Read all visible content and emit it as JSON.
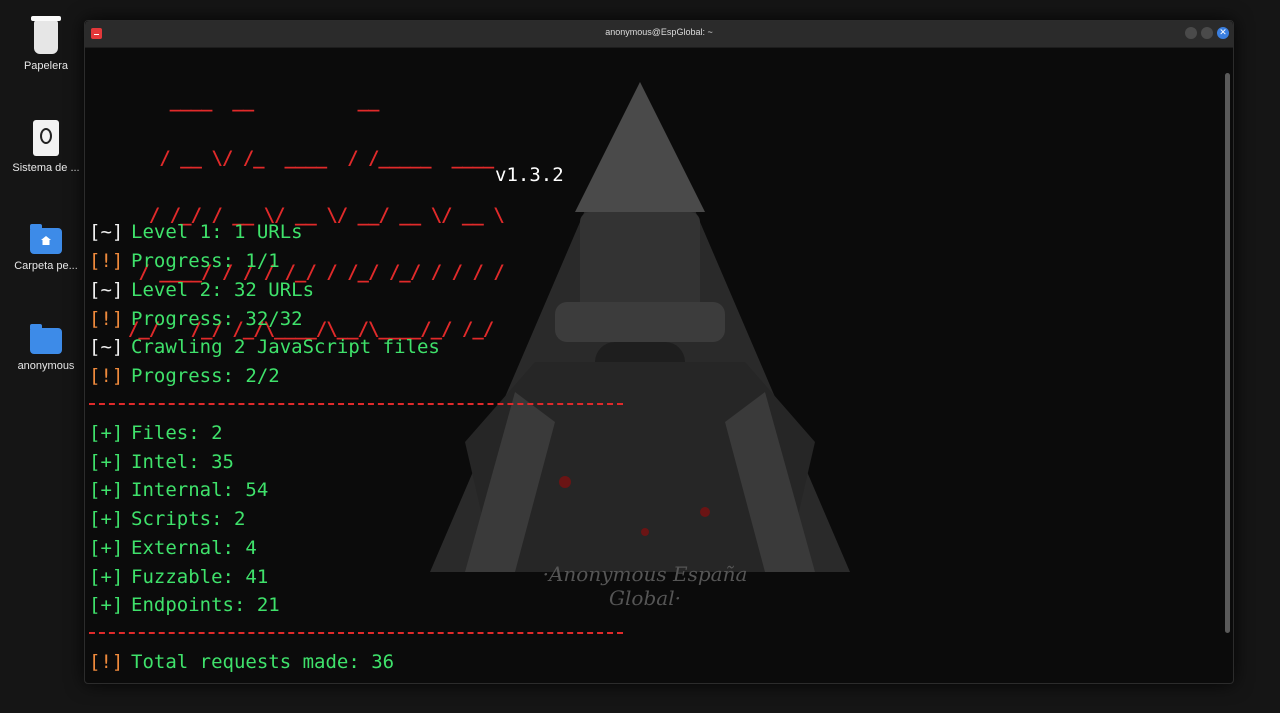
{
  "desktop": {
    "icons": [
      {
        "label": "Papelera",
        "icon": "trash-icon"
      },
      {
        "label": "Sistema de ...",
        "icon": "system-icon"
      },
      {
        "label": "Carpeta pe...",
        "icon": "home-folder-icon"
      },
      {
        "label": "anonymous",
        "icon": "folder-icon"
      }
    ]
  },
  "window": {
    "title": "anonymous@EspGlobal: ~",
    "close_glyph": "✕"
  },
  "terminal": {
    "banner": [
      "      ____  __          __",
      "     / __ \\/ /_  ____  / /_____  ____",
      "    / /_/ / __ \\/ __ \\/ __/ __ \\/ __ \\",
      "   / ____/ / / / /_/ / /_/ /_/ / / / /",
      "  /_/   /_/ /_/\\____/\\__/\\____/_/ /_/"
    ],
    "version": "v1.3.2",
    "watermark": "·Anonymous España Global·",
    "crawl_lines": [
      {
        "tag": "[~]",
        "text": "Level 1: 1 URLs"
      },
      {
        "tag": "[!]",
        "text": "Progress: 1/1"
      },
      {
        "tag": "[~]",
        "text": "Level 2: 32 URLs"
      },
      {
        "tag": "[!]",
        "text": "Progress: 32/32"
      },
      {
        "tag": "[~]",
        "text": "Crawling 2 JavaScript files"
      },
      {
        "tag": "[!]",
        "text": "Progress: 2/2"
      }
    ],
    "result_lines": [
      {
        "tag": "[+]",
        "text": "Files: 2"
      },
      {
        "tag": "[+]",
        "text": "Intel: 35"
      },
      {
        "tag": "[+]",
        "text": "Internal: 54"
      },
      {
        "tag": "[+]",
        "text": "Scripts: 2"
      },
      {
        "tag": "[+]",
        "text": "External: 4"
      },
      {
        "tag": "[+]",
        "text": "Fuzzable: 41"
      },
      {
        "tag": "[+]",
        "text": "Endpoints: 21"
      }
    ],
    "summary": {
      "tag": "[!]",
      "text": "Total requests made: 36"
    }
  },
  "colors": {
    "banner_red": "#e02a2a",
    "output_green": "#3fe26b",
    "tag_orange": "#ef8a3c",
    "tag_white": "#f0f0f0"
  }
}
